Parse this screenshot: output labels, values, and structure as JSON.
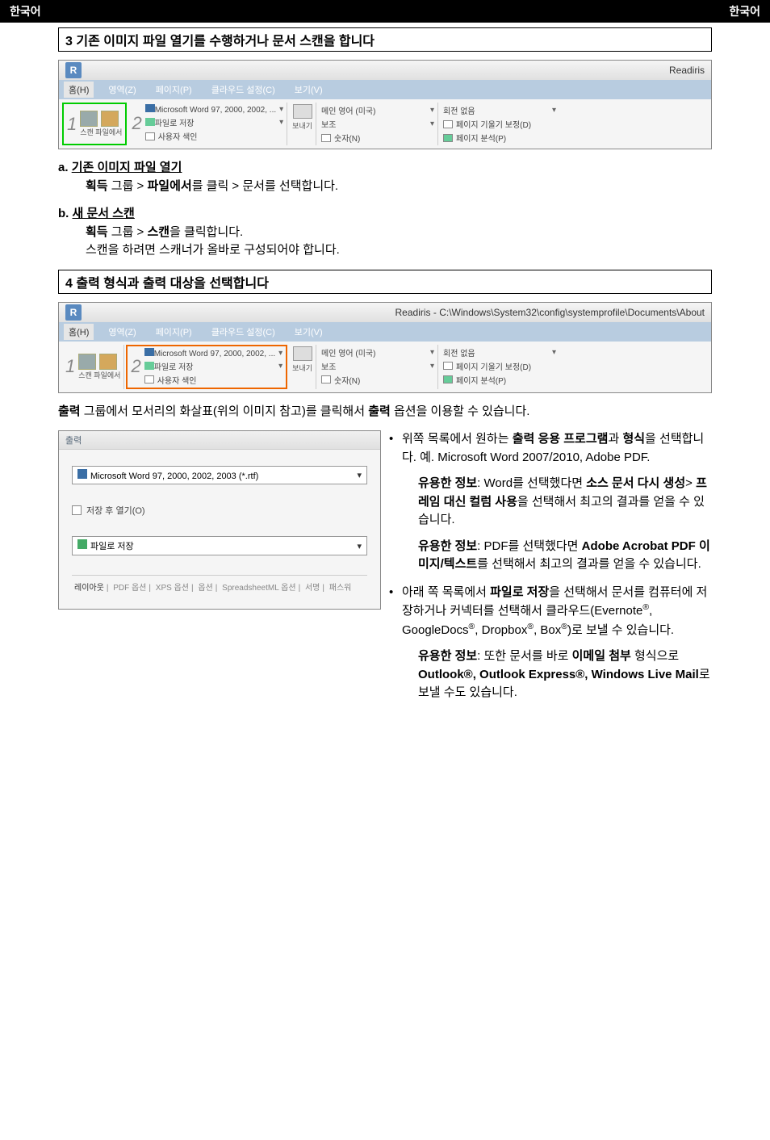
{
  "header": {
    "left": "한국어",
    "right": "한국어"
  },
  "section3": {
    "title": "3 기존 이미지 파일 열기를 수행하거나 문서 스캔을 합니다",
    "app_title": "Readiris",
    "tabs": {
      "home": "홈(H)",
      "area": "영역(Z)",
      "page": "페이지(P)",
      "cloud": "클라우드 설정(C)",
      "view": "보기(V)"
    },
    "ribbon": {
      "step1_num": "1",
      "scan_from_label": "스캔 파일에서",
      "step2_num": "2",
      "word_format": "Microsoft Word 97, 2000, 2002, ...",
      "save_file": "파일로 저장",
      "user_index": "사용자 색인",
      "send_label": "보내기",
      "main_lang": "메인 영어 (미국)",
      "assist": "보조",
      "numbers": "숫자(N)",
      "no_rotation": "회전 없음",
      "deskew": "페이지 기울기 보정(D)",
      "analyze": "페이지 분석(P)"
    },
    "item_a": {
      "label": "a.",
      "heading": "기존 이미지 파일 열기",
      "group": "획득",
      "sep": " 그룹 > ",
      "action": "파일에서",
      "rest": "를 클릭 > 문서를 선택합니다."
    },
    "item_b": {
      "label": "b.",
      "heading": "새 문서 스캔",
      "group": "획득",
      "sep": " 그룹 > ",
      "action": "스캔",
      "rest": "을 클릭합니다.",
      "note": "스캔을 하려면 스캐너가 올바로 구성되어야 합니다."
    }
  },
  "section4": {
    "title": "4 출력 형식과 출력 대상을 선택합니다",
    "app_title": "Readiris - C:\\Windows\\System32\\config\\systemprofile\\Documents\\About",
    "intro_pre": "출력",
    "intro_mid": " 그룹에서 모서리의 화살표(위의 이미지 참고)를 클릭해서 ",
    "intro_bold": "출력",
    "intro_post": " 옵션을 이용할 수 있습니다.",
    "dialog": {
      "title": "출력",
      "format": "Microsoft Word 97, 2000, 2002, 2003 (*.rtf)",
      "open_after": "저장 후 열기(O)",
      "save_as": "파일로 저장",
      "tabs": {
        "layout": "레이아웃",
        "pdf": "PDF 옵션",
        "xps": "XPS 옵션",
        "options": "옵션",
        "spreadsheet": "SpreadsheetML 옵션",
        "signature": "서명",
        "pass": "패스워"
      }
    },
    "bullets": {
      "b1_pre": "위쪽 목록에서 원하는 ",
      "b1_bold1": "출력 응용 프로그램",
      "b1_mid": "과 ",
      "b1_bold2": "형식",
      "b1_post": "을 선택합니다. 예. Microsoft Word 2007/2010, Adobe PDF.",
      "tip1_label": "유용한 정보",
      "tip1_a": ": Word를 선택했다면 ",
      "tip1_bold1": "소스 문서 다시 생성",
      "tip1_sep": "> ",
      "tip1_bold2": "프레임 대신 컬럼 사용",
      "tip1_post": "을 선택해서 최고의 결과를 얻을 수 있습니다.",
      "tip2_label": "유용한 정보",
      "tip2_a": ": PDF를 선택했다면 ",
      "tip2_bold": "Adobe Acrobat PDF 이미지/텍스트",
      "tip2_post": "를 선택해서 최고의 결과를 얻을 수 있습니다.",
      "b2_pre": "아래 쪽 목록에서 ",
      "b2_bold": "파일로 저장",
      "b2_post1": "을 선택해서 문서를 컴퓨터에 저장하거나 커넥터를 선택해서 클라우드(Evernote",
      "b2_post2": ", GoogleDocs",
      "b2_post3": ", Dropbox",
      "b2_post4": ", Box",
      "b2_post5": ")로 보낼 수 있습니다.",
      "tip3_label": "유용한 정보",
      "tip3_a": ": 또한 문서를 바로 ",
      "tip3_bold1": "이메일 첨부",
      "tip3_mid": " 형식으로 ",
      "tip3_bold2": "Outlook®, Outlook Express®, Windows Live Mail",
      "tip3_post": "로 보낼 수도 있습니다."
    }
  },
  "reg": "®"
}
